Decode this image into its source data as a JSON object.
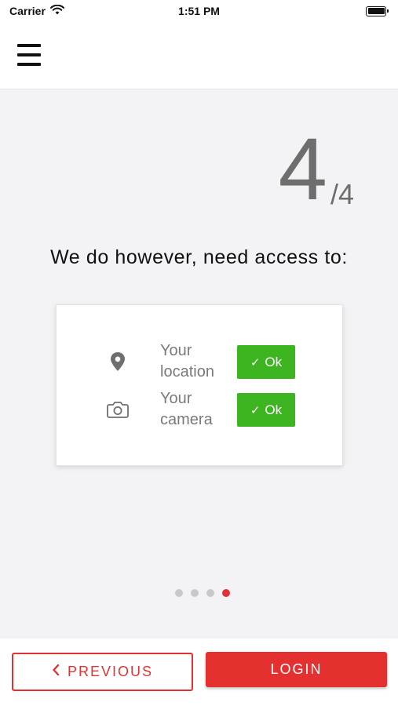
{
  "status_bar": {
    "carrier": "Carrier",
    "time": "1:51 PM",
    "icons": [
      "wifi-icon",
      "battery-icon"
    ]
  },
  "header": {
    "menu_icon": "hamburger-menu-icon"
  },
  "step": {
    "current": "4",
    "total": "/4"
  },
  "heading": "We do however, need access to:",
  "permissions": [
    {
      "icon": "location-pin-icon",
      "label": "Your location",
      "button": "Ok"
    },
    {
      "icon": "camera-icon",
      "label": "Your camera",
      "button": "Ok"
    }
  ],
  "pager": {
    "count": 4,
    "active_index": 3
  },
  "footer": {
    "previous_label": "PREVIOUS",
    "login_label": "LOGIN"
  },
  "colors": {
    "accent": "#e53030",
    "ok_green": "#3cb521",
    "background": "#f3f3f5"
  }
}
